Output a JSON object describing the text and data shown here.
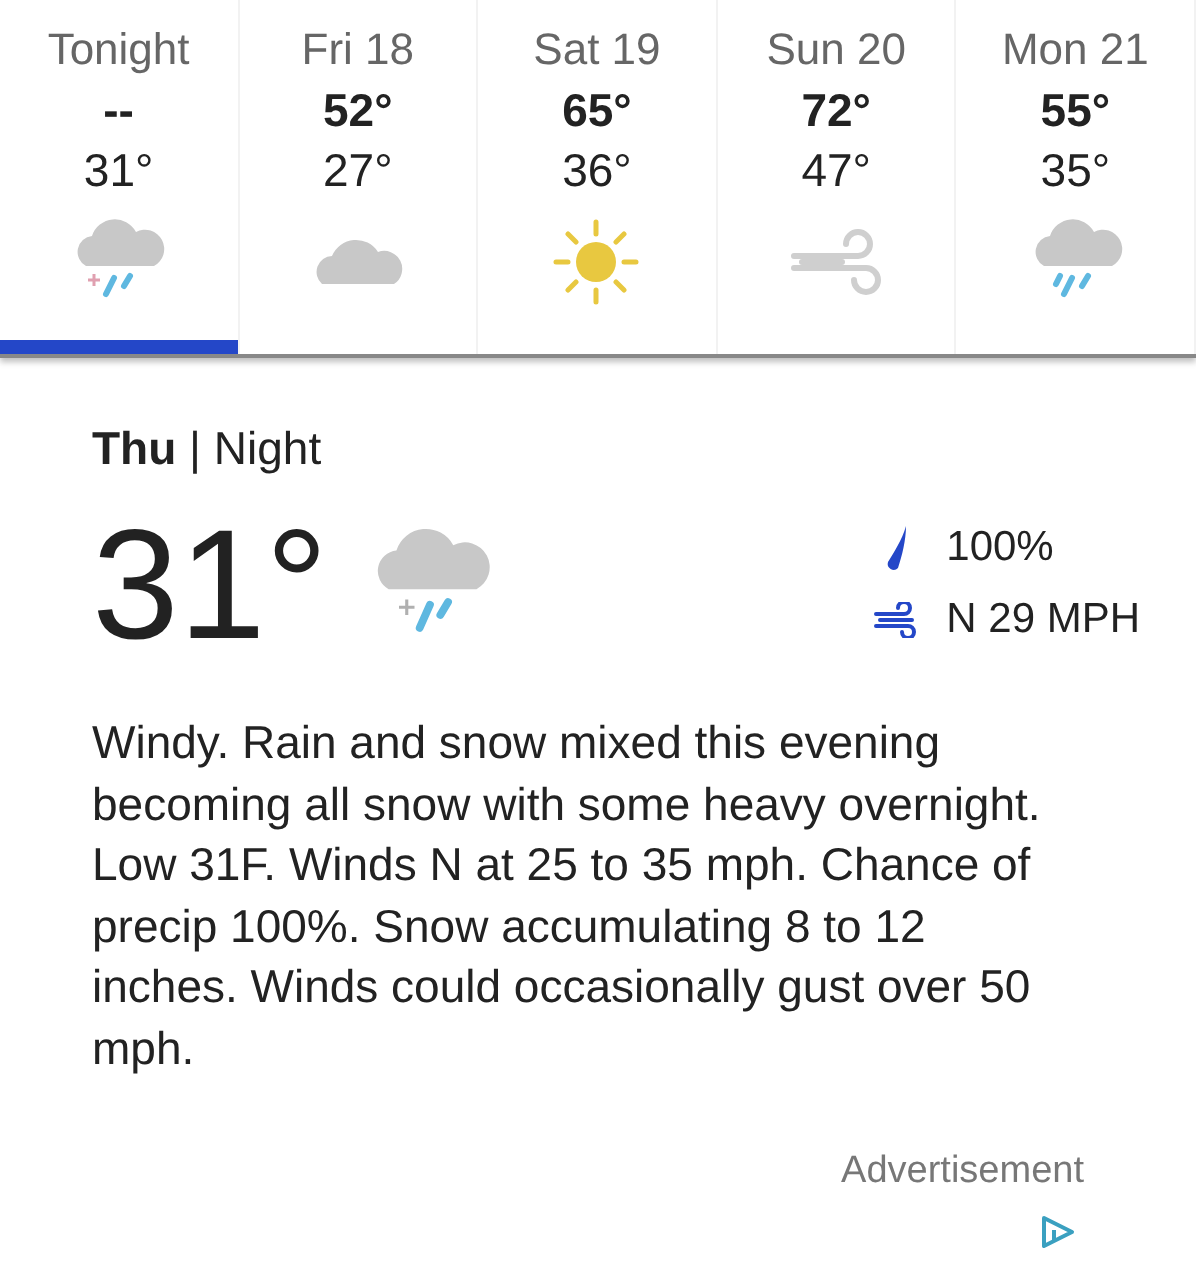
{
  "forecast_tabs": [
    {
      "label": "Tonight",
      "high": "--",
      "low": "31°",
      "kind": "snow-rain",
      "selected": true
    },
    {
      "label": "Fri 18",
      "high": "52°",
      "low": "27°",
      "kind": "cloud",
      "selected": false
    },
    {
      "label": "Sat 19",
      "high": "65°",
      "low": "36°",
      "kind": "sun",
      "selected": false
    },
    {
      "label": "Sun 20",
      "high": "72°",
      "low": "47°",
      "kind": "wind",
      "selected": false
    },
    {
      "label": "Mon 21",
      "high": "55°",
      "low": "35°",
      "kind": "rain",
      "selected": false
    }
  ],
  "detail": {
    "heading": "**Thu** | Night",
    "temperature": "31°",
    "kind": "snow-rain",
    "precipitation": "100%",
    "wind": "N 29 MPH",
    "description": "Windy. Rain and snow mixed this evening becoming all snow with some heavy overnight. Low 31F. Winds N at 25 to 35 mph. Chance of precip 100%. Snow accumulating 8 to 12 inches.  Winds could occasionally gust over 50 mph."
  },
  "advertisement": {
    "label": "Advertisement"
  }
}
